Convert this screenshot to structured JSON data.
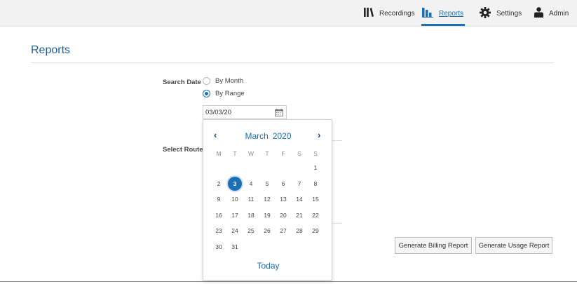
{
  "nav": {
    "recordings": "Recordings",
    "reports": "Reports",
    "settings": "Settings",
    "admin": "Admin",
    "active": "reports"
  },
  "page": {
    "title": "Reports"
  },
  "form": {
    "search_date_label": "Search Date",
    "by_month": "By Month",
    "by_range": "By Range",
    "selected_mode": "By Range",
    "date_value": "03/03/20",
    "select_route_label": "Select Route"
  },
  "datepicker": {
    "prev": "‹",
    "next": "›",
    "month": "March",
    "year": "2020",
    "weekdays": [
      "M",
      "T",
      "W",
      "T",
      "F",
      "S",
      "S"
    ],
    "weeks": [
      [
        "",
        "",
        "",
        "",
        "",
        "",
        "1"
      ],
      [
        "2",
        "3",
        "4",
        "5",
        "6",
        "7",
        "8"
      ],
      [
        "9",
        "10",
        "11",
        "12",
        "13",
        "14",
        "15"
      ],
      [
        "16",
        "17",
        "18",
        "19",
        "20",
        "21",
        "22"
      ],
      [
        "23",
        "24",
        "25",
        "26",
        "27",
        "28",
        "29"
      ],
      [
        "30",
        "31",
        "",
        "",
        "",
        "",
        ""
      ]
    ],
    "selected_day": "3",
    "today": "Today"
  },
  "buttons": {
    "billing": "Generate Billing Report",
    "usage": "Generate Usage Report"
  },
  "colors": {
    "accent": "#1a6fb5",
    "title": "#1f5f99",
    "topbar_bg": "#f2f2f2"
  }
}
